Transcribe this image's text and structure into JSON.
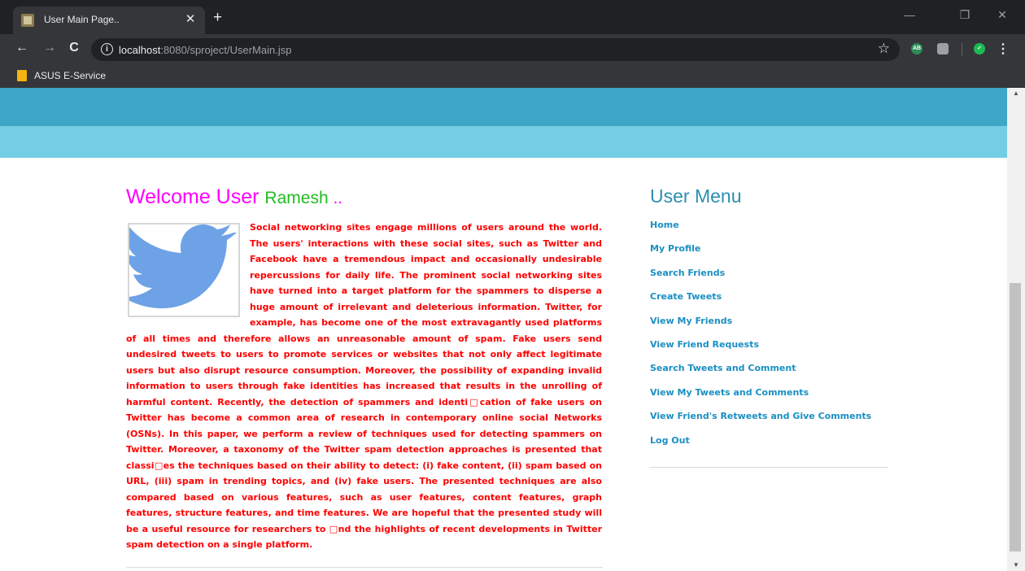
{
  "browser": {
    "tab": {
      "title": "User Main Page..",
      "close": "✕"
    },
    "new_tab": "+",
    "window": {
      "minimize": "—",
      "restore": "❐",
      "close": "✕"
    },
    "nav": {
      "back": "←",
      "forward": "→",
      "reload": "C"
    },
    "address": {
      "host": "localhost",
      "rest": ":8080/sproject/UserMain.jsp"
    },
    "bookmark_star": "☆",
    "extensions": [
      {
        "name": "adblock-icon",
        "label": "AB",
        "color": "#2e8b57"
      },
      {
        "name": "drive-icon",
        "label": "",
        "color": "#9aa0a6"
      },
      {
        "name": "shield-check-icon",
        "label": "✓",
        "color": "#1db954"
      }
    ],
    "menu": "⋮",
    "bookmarks": [
      {
        "label": "ASUS E-Service"
      }
    ]
  },
  "page": {
    "welcome": {
      "prefix": "Welcome User ",
      "name": "Ramesh",
      "suffix": " .."
    },
    "description": "Social networking sites engage millions of users around the world. The users' interactions with these social sites, such as Twitter and Facebook have a tremendous impact and occasionally undesirable repercussions for daily life. The prominent social networking sites have turned into a target platform for the spammers to disperse a huge amount of irrelevant and deleterious information. Twitter, for example, has become one of the most extravagantly used platforms of all times and therefore allows an unreasonable amount of spam. Fake users send undesired tweets to users to promote services or websites that not only affect legitimate users but also disrupt resource consumption. Moreover, the possibility of expanding invalid information to users through fake identities has increased that results in the unrolling of harmful content. Recently, the detection of spammers and identi□cation of fake users on Twitter has become a common area of research in contemporary online social Networks (OSNs). In this paper, we perform a review of techniques used for detecting spammers on Twitter. Moreover, a taxonomy of the Twitter spam detection approaches is presented that classi□es the techniques based on their ability to detect: (i) fake content, (ii) spam based on URL, (iii) spam in trending topics, and (iv) fake users. The presented techniques are also compared based on various features, such as user features, content features, graph features, structure features, and time features. We are hopeful that the presented study will be a useful resource for researchers to □nd the highlights of recent developments in Twitter spam detection on a single platform.",
    "menu": {
      "title": "User Menu",
      "items": [
        {
          "label": "Home"
        },
        {
          "label": "My Profile"
        },
        {
          "label": "Search Friends"
        },
        {
          "label": "Create Tweets"
        },
        {
          "label": "View My Friends"
        },
        {
          "label": "View Friend Requests"
        },
        {
          "label": "Search Tweets and Comment"
        },
        {
          "label": "View My Tweets and Comments"
        },
        {
          "label": "View Friend's Retweets and Give Comments"
        },
        {
          "label": "Log Out"
        }
      ]
    }
  }
}
